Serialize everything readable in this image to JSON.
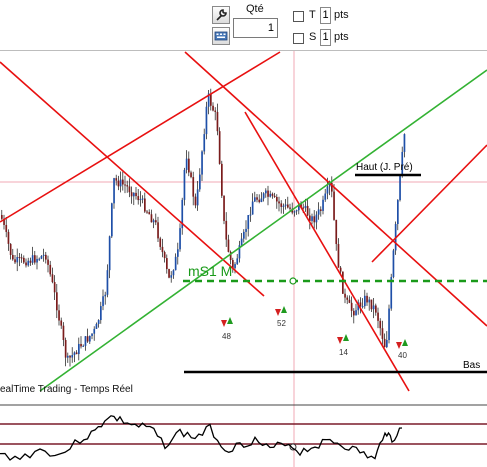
{
  "toolbar": {
    "qty_label": "Qté",
    "qty_value": "1",
    "row1": {
      "flag": "T",
      "pts_value": "1",
      "pts_label": "pts"
    },
    "row2": {
      "flag": "S",
      "pts_value": "1",
      "pts_label": "pts"
    }
  },
  "chart": {
    "watermark": "ealTime Trading - Temps Réel",
    "support_label": "mS1 M",
    "high_label": "Haut (J. Pré)",
    "low_label": "Bas",
    "signals": [
      "48",
      "52",
      "14",
      "40"
    ],
    "colors": {
      "up_candle": "#1f4fa8",
      "down_candle": "#7a1c1c",
      "trend_red": "#e81010",
      "trend_green": "#33b233",
      "support_dash": "#1a9a1a",
      "level_line": "#000000",
      "grid_pink": "#f2a8b6"
    }
  }
}
